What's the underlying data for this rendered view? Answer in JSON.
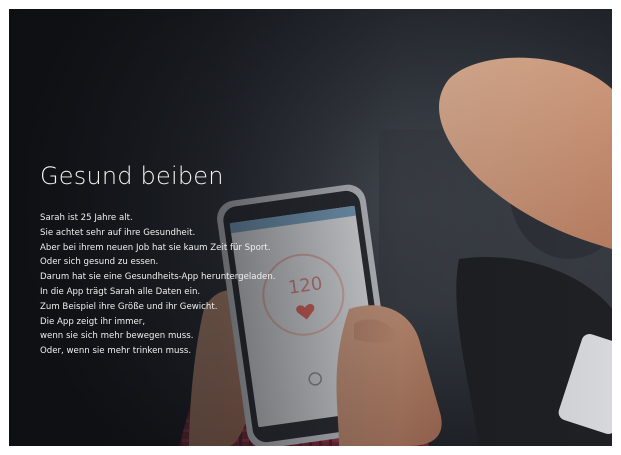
{
  "slide": {
    "title": "Gesund beiben",
    "lines": [
      "Sarah ist 25 Jahre alt.",
      "Sie achtet sehr auf ihre Gesundheit.",
      "Aber bei ihrem neuen Job hat sie kaum Zeit für Sport.",
      "Oder sich gesund zu essen.",
      "Darum hat sie eine Gesundheits-App heruntergeladen.",
      "In die App trägt Sarah alle Daten ein.",
      "Zum Beispiel ihre Größe und ihr Gewicht.",
      "Die App zeigt ihr immer,",
      "wenn sie sich mehr bewegen muss.",
      "Oder, wenn sie mehr trinken muss."
    ]
  },
  "phone_screen": {
    "heart_rate": "120",
    "heart_icon": "heart-icon"
  },
  "colors": {
    "background_dark": "#1a1d22",
    "text": "#ffffff",
    "heart": "#e0685c"
  }
}
